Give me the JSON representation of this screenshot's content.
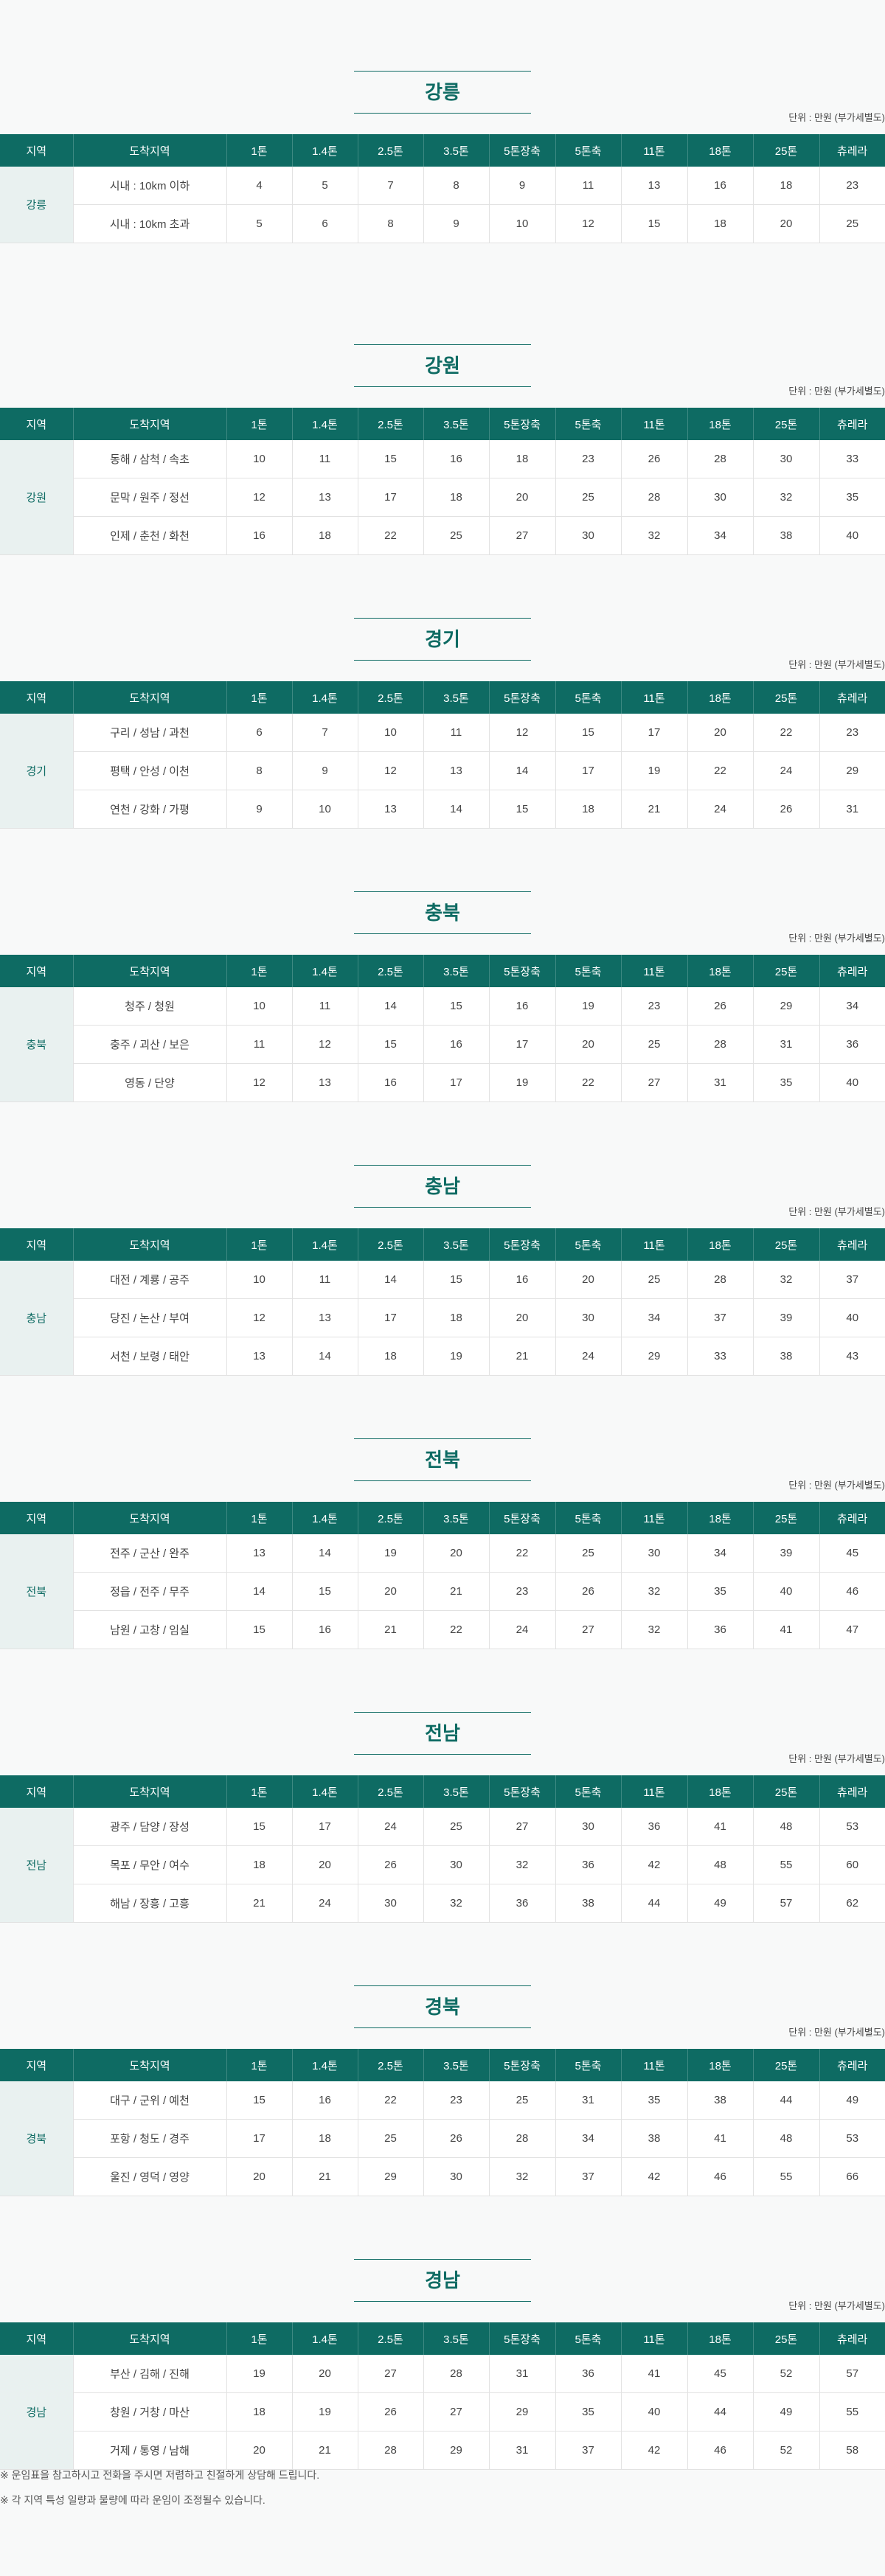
{
  "unit_label": "단위 : 만원 (부가세별도)",
  "columns": [
    "지역",
    "도착지역",
    "1톤",
    "1.4톤",
    "2.5톤",
    "3.5톤",
    "5톤장축",
    "5톤축",
    "11톤",
    "18톤",
    "25톤",
    "츄레라"
  ],
  "sections": [
    {
      "title": "강릉",
      "region": "강릉",
      "rows": [
        {
          "dest": "시내 : 10km 이하",
          "values": [
            "4",
            "5",
            "7",
            "8",
            "9",
            "11",
            "13",
            "16",
            "18",
            "23"
          ]
        },
        {
          "dest": "시내 : 10km 초과",
          "values": [
            "5",
            "6",
            "8",
            "9",
            "10",
            "12",
            "15",
            "18",
            "20",
            "25"
          ]
        }
      ]
    },
    {
      "title": "강원",
      "region": "강원",
      "rows": [
        {
          "dest": "동해 / 삼척 / 속초",
          "values": [
            "10",
            "11",
            "15",
            "16",
            "18",
            "23",
            "26",
            "28",
            "30",
            "33"
          ]
        },
        {
          "dest": "문막 / 원주 / 정선",
          "values": [
            "12",
            "13",
            "17",
            "18",
            "20",
            "25",
            "28",
            "30",
            "32",
            "35"
          ]
        },
        {
          "dest": "인제 / 춘천 / 화천",
          "values": [
            "16",
            "18",
            "22",
            "25",
            "27",
            "30",
            "32",
            "34",
            "38",
            "40"
          ]
        }
      ]
    },
    {
      "title": "경기",
      "region": "경기",
      "rows": [
        {
          "dest": "구리 / 성남 / 과천",
          "values": [
            "6",
            "7",
            "10",
            "11",
            "12",
            "15",
            "17",
            "20",
            "22",
            "23"
          ]
        },
        {
          "dest": "평택 / 안성 / 이천",
          "values": [
            "8",
            "9",
            "12",
            "13",
            "14",
            "17",
            "19",
            "22",
            "24",
            "29"
          ]
        },
        {
          "dest": "연천 / 강화 / 가평",
          "values": [
            "9",
            "10",
            "13",
            "14",
            "15",
            "18",
            "21",
            "24",
            "26",
            "31"
          ]
        }
      ]
    },
    {
      "title": "충북",
      "region": "충북",
      "rows": [
        {
          "dest": "청주 / 청원",
          "values": [
            "10",
            "11",
            "14",
            "15",
            "16",
            "19",
            "23",
            "26",
            "29",
            "34"
          ]
        },
        {
          "dest": "충주 / 괴산 / 보은",
          "values": [
            "11",
            "12",
            "15",
            "16",
            "17",
            "20",
            "25",
            "28",
            "31",
            "36"
          ]
        },
        {
          "dest": "영동 / 단양",
          "values": [
            "12",
            "13",
            "16",
            "17",
            "19",
            "22",
            "27",
            "31",
            "35",
            "40"
          ]
        }
      ]
    },
    {
      "title": "충남",
      "region": "충남",
      "rows": [
        {
          "dest": "대전 / 계룡 / 공주",
          "values": [
            "10",
            "11",
            "14",
            "15",
            "16",
            "20",
            "25",
            "28",
            "32",
            "37"
          ]
        },
        {
          "dest": "당진 / 논산 / 부여",
          "values": [
            "12",
            "13",
            "17",
            "18",
            "20",
            "30",
            "34",
            "37",
            "39",
            "40"
          ]
        },
        {
          "dest": "서천 / 보령 / 태안",
          "values": [
            "13",
            "14",
            "18",
            "19",
            "21",
            "24",
            "29",
            "33",
            "38",
            "43"
          ]
        }
      ]
    },
    {
      "title": "전북",
      "region": "전북",
      "rows": [
        {
          "dest": "전주 / 군산 / 완주",
          "values": [
            "13",
            "14",
            "19",
            "20",
            "22",
            "25",
            "30",
            "34",
            "39",
            "45"
          ]
        },
        {
          "dest": "정읍 / 전주 / 무주",
          "values": [
            "14",
            "15",
            "20",
            "21",
            "23",
            "26",
            "32",
            "35",
            "40",
            "46"
          ]
        },
        {
          "dest": "남원 / 고창 / 임실",
          "values": [
            "15",
            "16",
            "21",
            "22",
            "24",
            "27",
            "32",
            "36",
            "41",
            "47"
          ]
        }
      ]
    },
    {
      "title": "전남",
      "region": "전남",
      "rows": [
        {
          "dest": "광주 / 담양 / 장성",
          "values": [
            "15",
            "17",
            "24",
            "25",
            "27",
            "30",
            "36",
            "41",
            "48",
            "53"
          ]
        },
        {
          "dest": "목포 / 무안 / 여수",
          "values": [
            "18",
            "20",
            "26",
            "30",
            "32",
            "36",
            "42",
            "48",
            "55",
            "60"
          ]
        },
        {
          "dest": "해남 / 장흥 / 고흥",
          "values": [
            "21",
            "24",
            "30",
            "32",
            "36",
            "38",
            "44",
            "49",
            "57",
            "62"
          ]
        }
      ]
    },
    {
      "title": "경북",
      "region": "경북",
      "rows": [
        {
          "dest": "대구 / 군위 / 예천",
          "values": [
            "15",
            "16",
            "22",
            "23",
            "25",
            "31",
            "35",
            "38",
            "44",
            "49"
          ]
        },
        {
          "dest": "포항 / 청도 / 경주",
          "values": [
            "17",
            "18",
            "25",
            "26",
            "28",
            "34",
            "38",
            "41",
            "48",
            "53"
          ]
        },
        {
          "dest": "울진 / 영덕 / 영양",
          "values": [
            "20",
            "21",
            "29",
            "30",
            "32",
            "37",
            "42",
            "46",
            "55",
            "66"
          ]
        }
      ]
    },
    {
      "title": "경남",
      "region": "경남",
      "rows": [
        {
          "dest": "부산 / 김해 / 진해",
          "values": [
            "19",
            "20",
            "27",
            "28",
            "31",
            "36",
            "41",
            "45",
            "52",
            "57"
          ]
        },
        {
          "dest": "창원 / 거창 / 마산",
          "values": [
            "18",
            "19",
            "26",
            "27",
            "29",
            "35",
            "40",
            "44",
            "49",
            "55"
          ]
        },
        {
          "dest": "거제 / 통영 / 남해",
          "values": [
            "20",
            "21",
            "28",
            "29",
            "31",
            "37",
            "42",
            "46",
            "52",
            "58"
          ]
        }
      ]
    }
  ],
  "notes": [
    "※ 운임표을 참고하시고 전화을 주시면 저렴하고 친절하게 상담해 드립니다.",
    "※ 각 지역 특성 일량과 물량에 따라 운임이 조정될수 있습니다."
  ]
}
